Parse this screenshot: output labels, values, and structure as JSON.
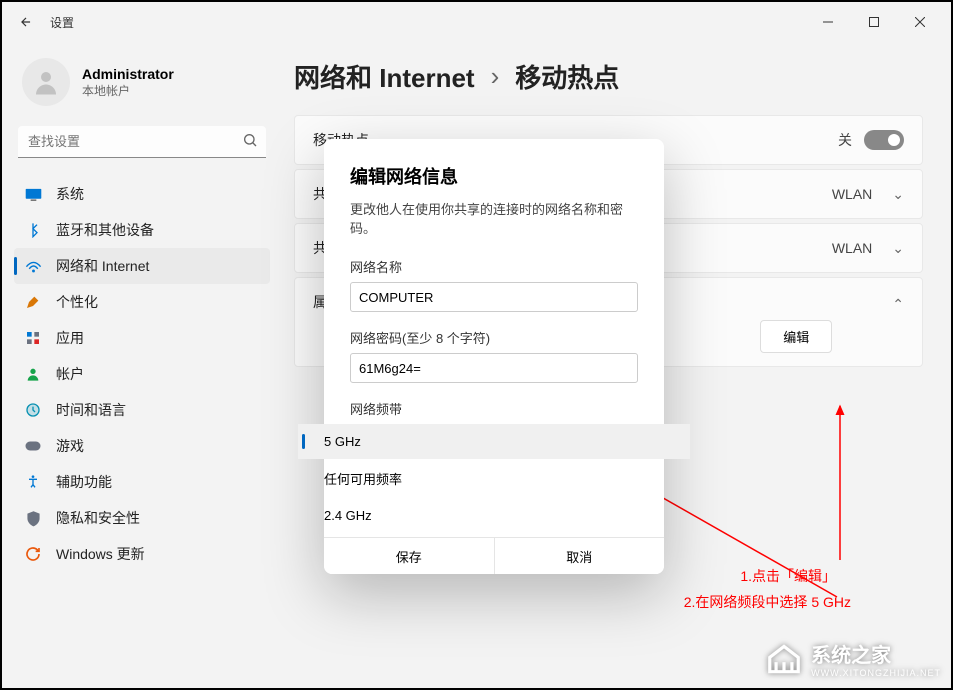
{
  "titlebar": {
    "title": "设置"
  },
  "user": {
    "name": "Administrator",
    "sub": "本地帐户"
  },
  "search": {
    "placeholder": "查找设置"
  },
  "nav": [
    {
      "label": "系统",
      "icon": "system"
    },
    {
      "label": "蓝牙和其他设备",
      "icon": "bluetooth"
    },
    {
      "label": "网络和 Internet",
      "icon": "network",
      "active": true
    },
    {
      "label": "个性化",
      "icon": "personalize"
    },
    {
      "label": "应用",
      "icon": "apps"
    },
    {
      "label": "帐户",
      "icon": "accounts"
    },
    {
      "label": "时间和语言",
      "icon": "time"
    },
    {
      "label": "游戏",
      "icon": "gaming"
    },
    {
      "label": "辅助功能",
      "icon": "accessibility"
    },
    {
      "label": "隐私和安全性",
      "icon": "privacy"
    },
    {
      "label": "Windows 更新",
      "icon": "update"
    }
  ],
  "breadcrumb": {
    "a": "网络和 Internet",
    "b": "移动热点"
  },
  "cards": {
    "hotspot": {
      "label": "移动热点",
      "state": "关"
    },
    "share_from": {
      "label": "共",
      "value": "WLAN"
    },
    "share_over": {
      "label": "共",
      "value": "WLAN"
    },
    "properties": {
      "label": "属",
      "edit": "编辑"
    }
  },
  "modal": {
    "title": "编辑网络信息",
    "desc": "更改他人在使用你共享的连接时的网络名称和密码。",
    "name_label": "网络名称",
    "name_value": "COMPUTER",
    "pwd_label": "网络密码(至少 8 个字符)",
    "pwd_value": "61M6g24=",
    "band_label": "网络频带",
    "bands": [
      "5 GHz",
      "任何可用频率",
      "2.4 GHz"
    ],
    "save": "保存",
    "cancel": "取消"
  },
  "annotations": {
    "l1": "1.点击「编辑」",
    "l2": "2.在网络频段中选择 5 GHz"
  },
  "watermark": {
    "name": "系统之家",
    "url": "WWW.XITONGZHIJIA.NET"
  }
}
